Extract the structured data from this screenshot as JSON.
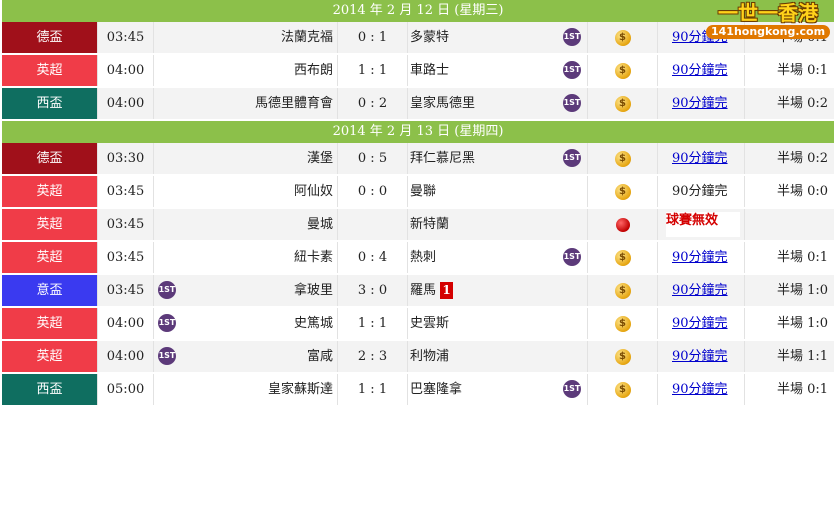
{
  "logo": {
    "title": "一世一香港",
    "domain": "141hongkong.com"
  },
  "days": [
    {
      "date": "2014 年 2 月 12 日 (星期三)",
      "matches": [
        {
          "league": "德盃",
          "league_key": "bund",
          "time": "03:45",
          "home": "法蘭克福",
          "home_first": false,
          "score": "0 : 1",
          "away": "多蒙特",
          "away_first": true,
          "away_red": "",
          "odds": "coin",
          "status": "90分鐘完",
          "status_link": true,
          "ht": "半場 0:1"
        },
        {
          "league": "英超",
          "league_key": "epl",
          "time": "04:00",
          "home": "西布朗",
          "home_first": false,
          "score": "1 : 1",
          "away": "車路士",
          "away_first": true,
          "away_red": "",
          "odds": "coin",
          "status": "90分鐘完",
          "status_link": true,
          "ht": "半場 0:1"
        },
        {
          "league": "西盃",
          "league_key": "lal",
          "time": "04:00",
          "home": "馬德里體育會",
          "home_first": false,
          "score": "0 : 2",
          "away": "皇家馬德里",
          "away_first": true,
          "away_red": "",
          "odds": "coin",
          "status": "90分鐘完",
          "status_link": true,
          "ht": "半場 0:2"
        }
      ]
    },
    {
      "date": "2014 年 2 月 13 日 (星期四)",
      "matches": [
        {
          "league": "德盃",
          "league_key": "bund",
          "time": "03:30",
          "home": "漢堡",
          "home_first": false,
          "score": "0 : 5",
          "away": "拜仁慕尼黑",
          "away_first": true,
          "away_red": "",
          "odds": "coin",
          "status": "90分鐘完",
          "status_link": true,
          "ht": "半場 0:2"
        },
        {
          "league": "英超",
          "league_key": "epl",
          "time": "03:45",
          "home": "阿仙奴",
          "home_first": false,
          "score": "0 : 0",
          "away": "曼聯",
          "away_first": false,
          "away_red": "",
          "odds": "coin",
          "status": "90分鐘完",
          "status_link": false,
          "ht": "半場 0:0"
        },
        {
          "league": "英超",
          "league_key": "epl",
          "time": "03:45",
          "home": "曼城",
          "home_first": false,
          "score": "",
          "away": "新特蘭",
          "away_first": false,
          "away_red": "",
          "odds": "red",
          "status": "球賽無效",
          "status_link": false,
          "void": true,
          "ht": ""
        },
        {
          "league": "英超",
          "league_key": "epl",
          "time": "03:45",
          "home": "紐卡素",
          "home_first": false,
          "score": "0 : 4",
          "away": "熱刺",
          "away_first": true,
          "away_red": "",
          "odds": "coin",
          "status": "90分鐘完",
          "status_link": true,
          "ht": "半場 0:1"
        },
        {
          "league": "意盃",
          "league_key": "seria",
          "time": "03:45",
          "home": "拿玻里",
          "home_first": true,
          "score": "3 : 0",
          "away": "羅馬",
          "away_first": false,
          "away_red": "1",
          "odds": "coin",
          "status": "90分鐘完",
          "status_link": true,
          "ht": "半場 1:0"
        },
        {
          "league": "英超",
          "league_key": "epl",
          "time": "04:00",
          "home": "史篤城",
          "home_first": true,
          "score": "1 : 1",
          "away": "史雲斯",
          "away_first": false,
          "away_red": "",
          "odds": "coin",
          "status": "90分鐘完",
          "status_link": true,
          "ht": "半場 1:0"
        },
        {
          "league": "英超",
          "league_key": "epl",
          "time": "04:00",
          "home": "富咸",
          "home_first": true,
          "score": "2 : 3",
          "away": "利物浦",
          "away_first": false,
          "away_red": "",
          "odds": "coin",
          "status": "90分鐘完",
          "status_link": true,
          "ht": "半場 1:1"
        },
        {
          "league": "西盃",
          "league_key": "lal",
          "time": "05:00",
          "home": "皇家蘇斯達",
          "home_first": false,
          "score": "1 : 1",
          "away": "巴塞隆拿",
          "away_first": true,
          "away_red": "",
          "odds": "coin",
          "status": "90分鐘完",
          "status_link": true,
          "ht": "半場 0:1"
        }
      ]
    }
  ],
  "icons": {
    "first_goal": "1ST",
    "odds": "$"
  }
}
